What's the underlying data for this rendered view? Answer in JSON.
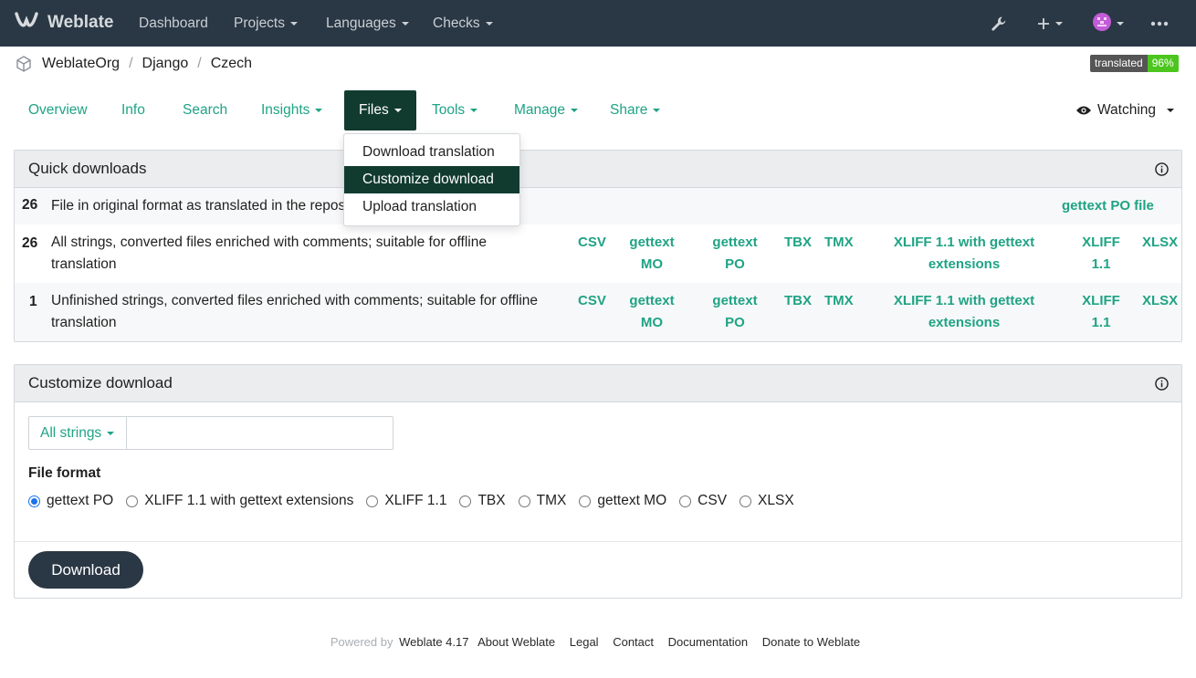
{
  "navbar": {
    "brand": "Weblate",
    "items": [
      "Dashboard",
      "Projects",
      "Languages",
      "Checks"
    ]
  },
  "breadcrumb": [
    "WeblateOrg",
    "Django",
    "Czech"
  ],
  "badge": {
    "label": "translated",
    "value": "96%"
  },
  "tabs": [
    "Overview",
    "Info",
    "Search",
    "Insights",
    "Files",
    "Tools",
    "Manage",
    "Share"
  ],
  "watch": {
    "label": "Watching"
  },
  "files_menu": [
    "Download translation",
    "Customize download",
    "Upload translation"
  ],
  "quick_downloads": {
    "title": "Quick downloads",
    "rows": [
      {
        "count": "26",
        "desc": "File in original format as translated in the repository",
        "formats": [
          "gettext PO file"
        ]
      },
      {
        "count": "26",
        "desc_line1": "All strings, converted files enriched with comments; suitable for offline",
        "desc_line2": "translation",
        "formats": [
          "CSV",
          "gettext MO",
          "gettext PO",
          "TBX",
          "TMX",
          "XLIFF 1.1 with gettext extensions",
          "XLIFF 1.1",
          "XLSX"
        ]
      },
      {
        "count": "1",
        "desc_line1": "Unfinished strings, converted files enriched with comments; suitable for offline",
        "desc_line2": "translation",
        "formats": [
          "CSV",
          "gettext MO",
          "gettext PO",
          "TBX",
          "TMX",
          "XLIFF 1.1 with gettext extensions",
          "XLIFF 1.1",
          "XLSX"
        ]
      }
    ],
    "fmt_split": {
      "gettext_mo": [
        "gettext",
        "MO"
      ],
      "gettext_po": [
        "gettext",
        "PO"
      ],
      "xliff_ext": [
        "XLIFF 1.1 with gettext",
        "extensions"
      ],
      "xliff": [
        "XLIFF",
        "1.1"
      ]
    }
  },
  "customize": {
    "title": "Customize download",
    "filter": "All strings",
    "query_value": "",
    "file_format_label": "File format",
    "formats": [
      "gettext PO",
      "XLIFF 1.1 with gettext extensions",
      "XLIFF 1.1",
      "TBX",
      "TMX",
      "gettext MO",
      "CSV",
      "XLSX"
    ],
    "selected": "gettext PO",
    "button": "Download"
  },
  "footer": {
    "powered": "Powered by",
    "links": [
      "Weblate 4.17",
      "About Weblate",
      "Legal",
      "Contact",
      "Documentation",
      "Donate to Weblate"
    ]
  },
  "colors": {
    "navbar": "#2a3744",
    "accent": "#1fa385",
    "active_tab": "#123b30",
    "badge_ok": "#4cc61e"
  }
}
